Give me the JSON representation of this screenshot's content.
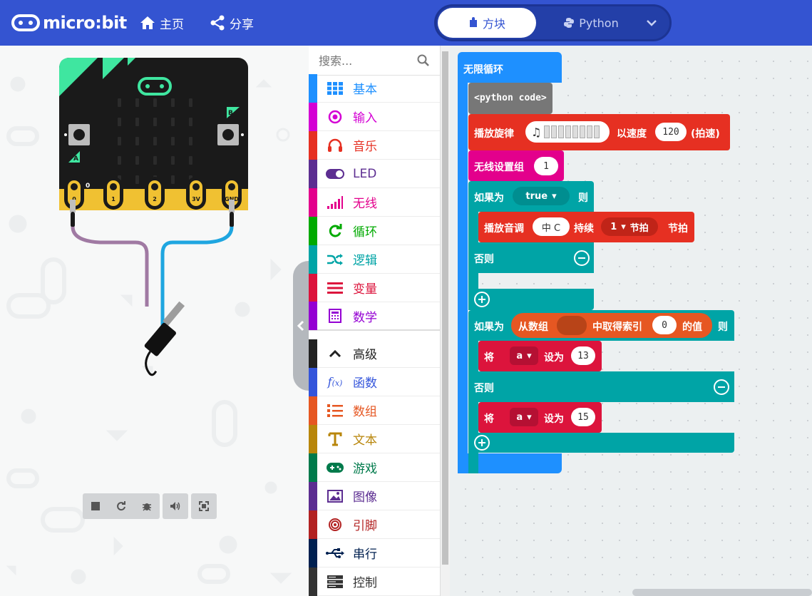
{
  "header": {
    "brand": "micro:bit",
    "nav": {
      "home": "主页",
      "share": "分享"
    },
    "editor_toggle": {
      "blocks": "方块",
      "python": "Python"
    }
  },
  "simulator": {
    "pin_labels": [
      "0",
      "1",
      "2",
      "3V",
      "GND"
    ],
    "button_a": "A",
    "button_b": "B",
    "zero_label": "0",
    "controls": [
      "stop-icon",
      "restart-icon",
      "debug-icon",
      "mute-icon",
      "fullscreen-icon"
    ]
  },
  "toolbox": {
    "search_placeholder": "搜索...",
    "categories": [
      {
        "label": "基本",
        "color": "#1e90ff",
        "icon": "grid-icon"
      },
      {
        "label": "输入",
        "color": "#d400d4",
        "icon": "target-icon"
      },
      {
        "label": "音乐",
        "color": "#e63022",
        "icon": "headphones-icon"
      },
      {
        "label": "LED",
        "color": "#5c2d91",
        "icon": "toggle-icon"
      },
      {
        "label": "无线",
        "color": "#e3008c",
        "icon": "signal-icon"
      },
      {
        "label": "循环",
        "color": "#00aa00",
        "icon": "refresh-icon"
      },
      {
        "label": "逻辑",
        "color": "#00a4a6",
        "icon": "shuffle-icon"
      },
      {
        "label": "变量",
        "color": "#dc143c",
        "icon": "lines-icon"
      },
      {
        "label": "数学",
        "color": "#9400d3",
        "icon": "calculator-icon"
      }
    ],
    "advanced": {
      "label": "高级",
      "color": "#222222"
    },
    "advanced_categories": [
      {
        "label": "函数",
        "color": "#3455db",
        "icon": "function-icon"
      },
      {
        "label": "数组",
        "color": "#e65722",
        "icon": "list-icon"
      },
      {
        "label": "文本",
        "color": "#b8860b",
        "icon": "text-icon"
      },
      {
        "label": "游戏",
        "color": "#007a4b",
        "icon": "gamepad-icon"
      },
      {
        "label": "图像",
        "color": "#5c2d91",
        "icon": "image-icon"
      },
      {
        "label": "引脚",
        "color": "#b22222",
        "icon": "pin-icon"
      },
      {
        "label": "串行",
        "color": "#002050",
        "icon": "usb-icon"
      },
      {
        "label": "控制",
        "color": "#333333",
        "icon": "server-icon"
      }
    ]
  },
  "workspace": {
    "forever": "无限循环",
    "python_code": "<python code>",
    "play_melody": "播放旋律",
    "at_tempo": "以速度",
    "tempo": "120",
    "bpm": "(拍速)",
    "radio_group": "无线设置组",
    "radio_group_value": "1",
    "if1": "如果为",
    "if1_cond": "true",
    "then": "则",
    "play_tone": "播放音调",
    "tone": "中 C",
    "for": "持续",
    "beats": "1",
    "beat_unit": "节拍",
    "beat_unit2": "节拍",
    "else1": "否则",
    "if2": "如果为",
    "from_array": "从数组",
    "get_index": "中取得索引",
    "index_value": "0",
    "value_of": "的值",
    "then2": "则",
    "set1": "将",
    "var1": "a",
    "set_to1": "设为",
    "val1": "13",
    "else2": "否则",
    "set2": "将",
    "var2": "a",
    "set_to2": "设为",
    "val2": "15"
  }
}
